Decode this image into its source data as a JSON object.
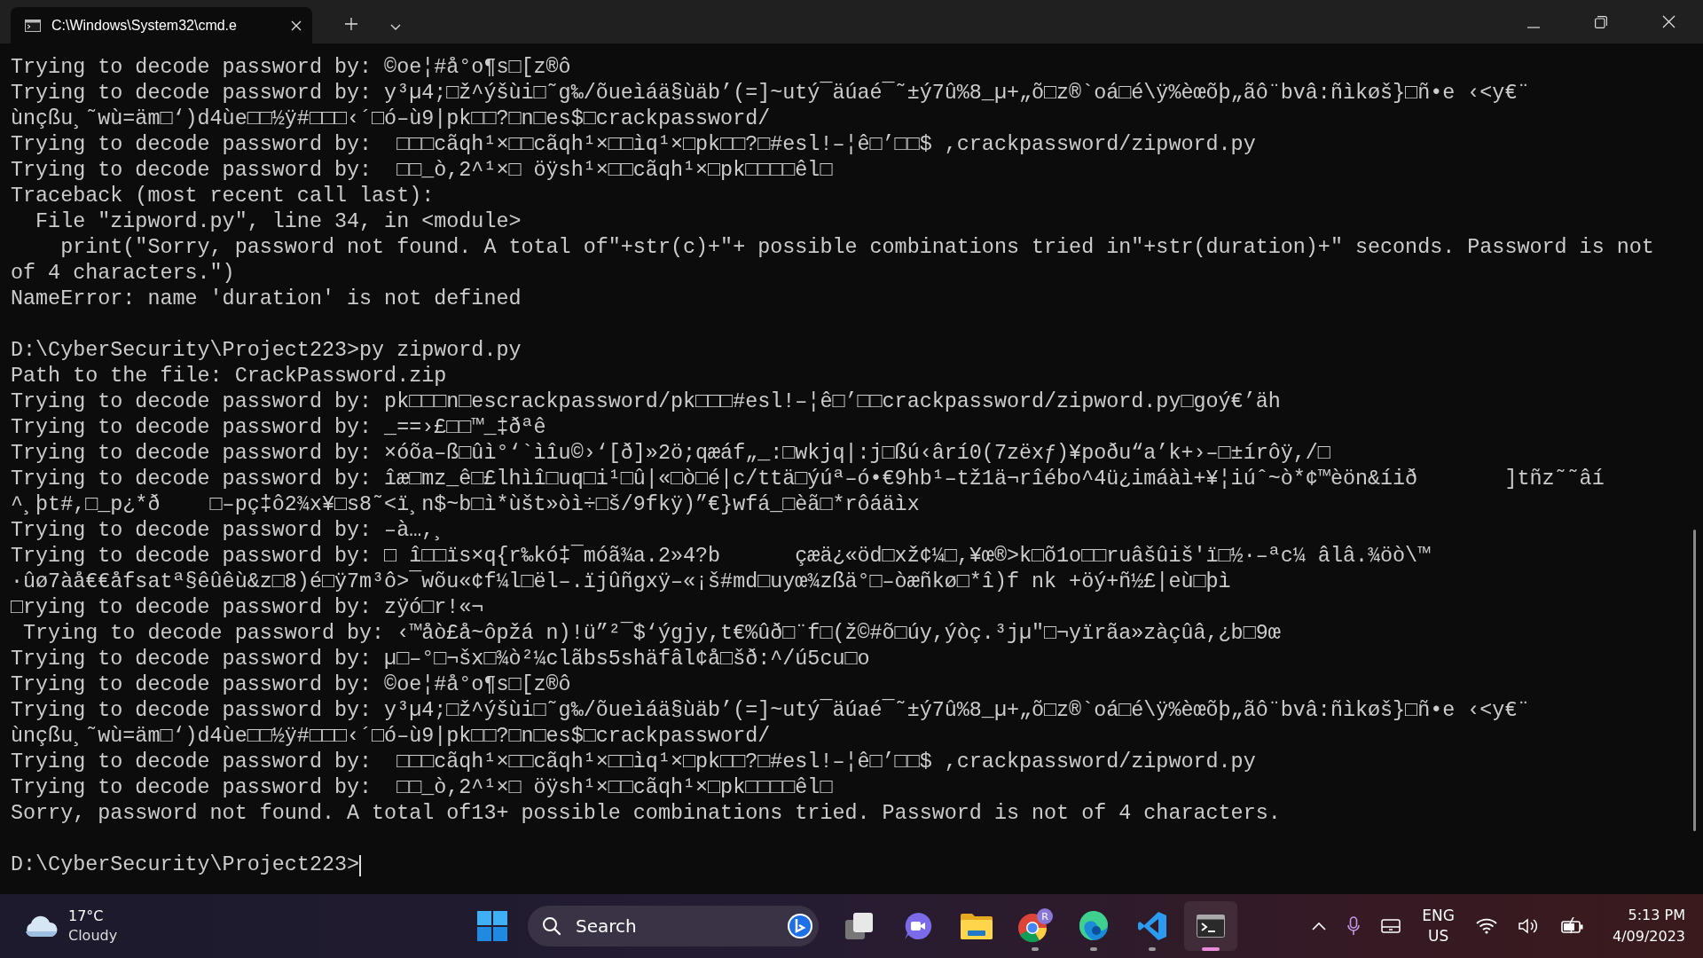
{
  "title_bar": {
    "tab": {
      "title": "C:\\Windows\\System32\\cmd.e",
      "selected": true
    }
  },
  "terminal": {
    "lines": [
      {
        "kind": "text",
        "text": "Trying to decode password by: ©oe¦#å°o¶s□[z®ô"
      },
      {
        "kind": "text",
        "text": "Trying to decode password by: y³µ4;□ž^ýšùi□˜g‰/õueìáä§ùäb’(=]~utý¯äúaé¯˜±ý7û%8_µ+„õ□z®`oá□é\\ÿ%èœõþ„ãô¨bvâ:ñìkøš}□ñ•e ‹<y€¨"
      },
      {
        "kind": "text",
        "text": "ùnçßu¸˜wù=äm□‘)d4ùe□□½ÿ#□□□‹´□ó–ù9|pk□□?□n□es$□crackpassword/"
      },
      {
        "kind": "text",
        "text": "Trying to decode password by:  □□□cãqh¹×□□cãqh¹×□□ìq¹×□pk□□?□#esl!–¦ê□’□□$ ,crackpassword/zipword.py"
      },
      {
        "kind": "text",
        "text": "Trying to decode password by:  □□_ò,2^¹×□ öÿsh¹×□□cãqh¹×□pk□□□□êl□"
      },
      {
        "kind": "text",
        "text": "Traceback (most recent call last):"
      },
      {
        "kind": "text",
        "text": "  File \"zipword.py\", line 34, in <module>"
      },
      {
        "kind": "text",
        "text": "    print(\"Sorry, password not found. A total of\"+str(c)+\"+ possible combinations tried in\"+str(duration)+\" seconds. Password is not"
      },
      {
        "kind": "text",
        "text": "of 4 characters.\")"
      },
      {
        "kind": "text",
        "text": "NameError: name 'duration' is not defined"
      },
      {
        "kind": "blank"
      },
      {
        "kind": "text",
        "text": "D:\\CyberSecurity\\Project223>py zipword.py"
      },
      {
        "kind": "text",
        "text": "Path to the file: CrackPassword.zip"
      },
      {
        "kind": "text",
        "text": "Trying to decode password by: pk□□□n□escrackpassword/pk□□□#esl!–¦ê□’□□crackpassword/zipword.py□goý€’äh"
      },
      {
        "kind": "text",
        "text": "Trying to decode password by: _==›£□□™_‡ðªê"
      },
      {
        "kind": "text",
        "text": "Trying to decode password by: ×óõa–ß□ûì°‘`ìîu©›‘[ð]»2ö;qæáf„_:□wkjq|:j□ßú‹ârí0(7zëxƒ)¥poðu“a’k+›–□±írôÿ,/□"
      },
      {
        "kind": "text",
        "text": "Trying to decode password by: îæ□mz_ê□£lhìî□uq□i¹□û|«□ò□é|c/ttä□ýúª–ó•€9hb¹–tž1ä¬rîébo^4ü¿imáàì+¥¦iúˆ~ò*¢™èön&íið       ]tñz˜˜âí"
      },
      {
        "kind": "text",
        "text": "^¸þt#,□_p¿*ð    □–pç‡ô2¾x¥□s8˜<ï¸n$~b□ì*ùšt»òì÷□š/9fkÿ)”€}wfá_□èã□*rôáäìx"
      },
      {
        "kind": "text",
        "text": "Trying to decode password by: –à…,¸"
      },
      {
        "kind": "text",
        "text": "Trying to decode password by: □ î□□ïs×q{r‰kó‡¯móã¾a.2»4?b      çæä¿«öd□xž¢¼□,¥œ®>k□õ1o□□ruâšûiš'ï□½·–ªc¼ âlâ.¾öò\\™"
      },
      {
        "kind": "text",
        "text": "·ûø7àå€€åfsatª§êûêù&z□8)é□ÿ7m³ô>¯wõu«¢f¼l□ël–.ïjûñgxÿ–«¡š#md□uyœ¾zßä°□–òæñkø□*î)f nk +öý+ñ½£|eù□þì"
      },
      {
        "kind": "text",
        "text": "□rying to decode password by: zÿó□r!«¬"
      },
      {
        "kind": "text",
        "text": " Trying to decode password by: ‹™åò£å~ôpžá n)!ü”²¯$‘ýgjy,t€%ûð□¨f□(ž©#õ□úy,ýòç.³jµ\"□¬yïrãa»zàçûâ,¿b□9œ"
      },
      {
        "kind": "text",
        "text": "Trying to decode password by: µ□–°□¬šx□¾ò²¼clãbs5shäfâl¢å□šð:^/ú5cu□o"
      },
      {
        "kind": "text",
        "text": "Trying to decode password by: ©oe¦#å°o¶s□[z®ô"
      },
      {
        "kind": "text",
        "text": "Trying to decode password by: y³µ4;□ž^ýšùi□˜g‰/õueìáä§ùäb’(=]~utý¯äúaé¯˜±ý7û%8_µ+„õ□z®`oá□é\\ÿ%èœõþ„ãô¨bvâ:ñìkøš}□ñ•e ‹<y€¨"
      },
      {
        "kind": "text",
        "text": "ùnçßu¸˜wù=äm□‘)d4ùe□□½ÿ#□□□‹´□ó–ù9|pk□□?□n□es$□crackpassword/"
      },
      {
        "kind": "text",
        "text": "Trying to decode password by:  □□□cãqh¹×□□cãqh¹×□□ìq¹×□pk□□?□#esl!–¦ê□’□□$ ,crackpassword/zipword.py"
      },
      {
        "kind": "text",
        "text": "Trying to decode password by:  □□_ò,2^¹×□ öÿsh¹×□□cãqh¹×□pk□□□□êl□"
      },
      {
        "kind": "text",
        "text": "Sorry, password not found. A total of13+ possible combinations tried. Password is not of 4 characters."
      },
      {
        "kind": "blank"
      },
      {
        "kind": "text",
        "text": "D:\\CyberSecurity\\Project223>",
        "cursor": true
      }
    ]
  },
  "taskbar": {
    "weather": {
      "temperature": "17°C",
      "condition": "Cloudy"
    },
    "search": {
      "placeholder": "Search"
    },
    "apps": [
      {
        "kind": "start",
        "running": false,
        "selected": false
      },
      {
        "kind": "search"
      },
      {
        "kind": "taskview",
        "running": false,
        "selected": false
      },
      {
        "kind": "meet",
        "running": false,
        "selected": false
      },
      {
        "kind": "explorer",
        "running": false,
        "selected": false
      },
      {
        "kind": "chrome",
        "running": true,
        "selected": false,
        "badge": "R"
      },
      {
        "kind": "edge",
        "running": true,
        "selected": false
      },
      {
        "kind": "vscode",
        "running": true,
        "selected": false
      },
      {
        "kind": "terminal",
        "running": true,
        "selected": true
      }
    ],
    "language": {
      "primary": "ENG",
      "secondary": "US"
    },
    "clock": {
      "time": "5:13 PM",
      "date": "4/09/2023"
    }
  }
}
